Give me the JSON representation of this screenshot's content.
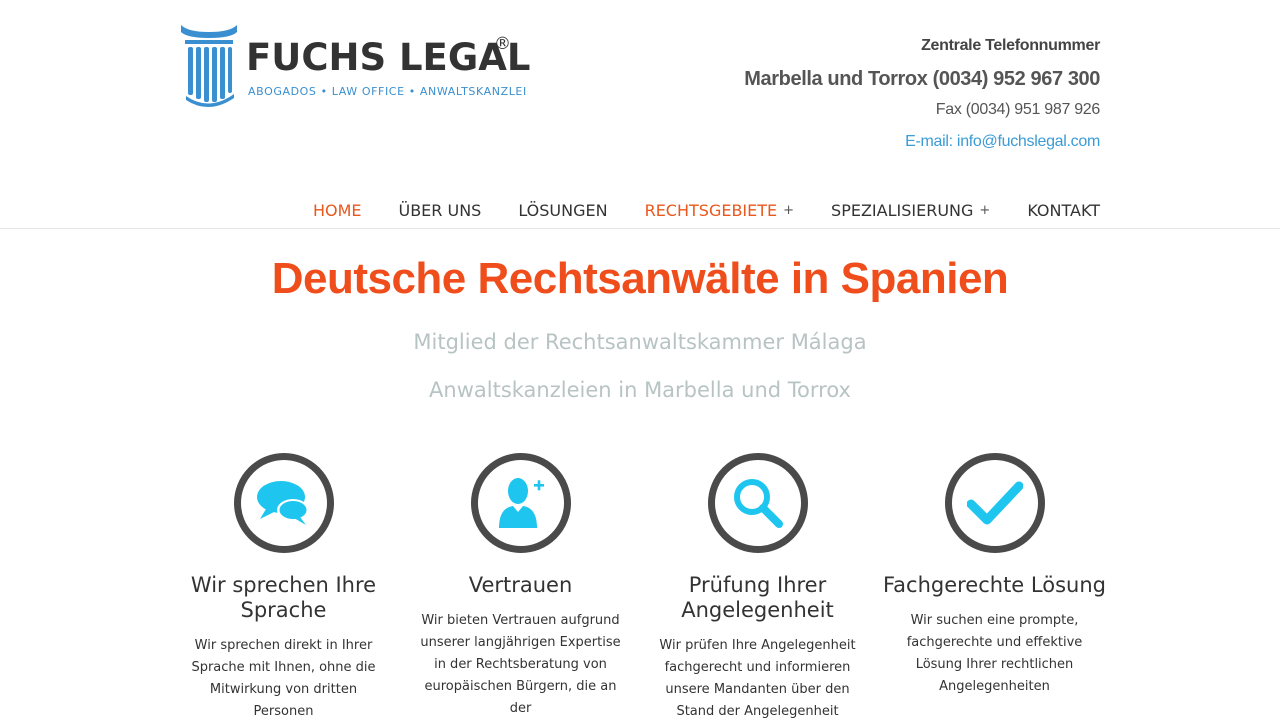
{
  "brand": {
    "name": "FUCHS LEGAL",
    "registered": "®",
    "tagline": "ABOGADOS  •  LAW OFFICE  •  ANWALTSKANZLEI",
    "colors": {
      "primary_blue": "#3a8fd0",
      "accent_orange": "#ef4e1c",
      "icon_cyan": "#1ec6ef"
    }
  },
  "contact": {
    "label": "Zentrale Telefonnummer",
    "phone": "Marbella und Torrox (0034) 952 967 300",
    "fax": "Fax (0034) 951 987 926",
    "email": "E-mail: info@fuchslegal.com"
  },
  "nav": {
    "items": [
      {
        "label": "HOME",
        "active": true
      },
      {
        "label": "ÜBER UNS"
      },
      {
        "label": "LÖSUNGEN"
      },
      {
        "label": "RECHTSGEBIETE",
        "active": true,
        "has_submenu": true
      },
      {
        "label": "SPEZIALISIERUNG",
        "has_submenu": true
      },
      {
        "label": "KONTAKT"
      }
    ],
    "submenu_symbol": "+"
  },
  "hero": {
    "title": "Deutsche Rechtsanwälte in Spanien",
    "subtitle1": "Mitglied der Rechtsanwaltskammer Málaga",
    "subtitle2": "Anwaltskanzleien in Marbella und Torrox"
  },
  "features": [
    {
      "icon": "chat-bubbles-icon",
      "title": "Wir sprechen Ihre Sprache",
      "text": "Wir sprechen direkt in Ihrer Sprache mit Ihnen, ohne die Mitwirkung von dritten Personen"
    },
    {
      "icon": "user-add-icon",
      "title": "Vertrauen",
      "text": "Wir bieten Vertrauen aufgrund unserer langjährigen Expertise in der Rechtsberatung von europäischen Bürgern, die an der"
    },
    {
      "icon": "magnifier-icon",
      "title": "Prüfung Ihrer Angelegenheit",
      "text": "Wir prüfen Ihre Angelegenheit fachgerecht und informieren unsere Mandanten über den Stand der Angelegenheit"
    },
    {
      "icon": "checkmark-icon",
      "title": "Fachgerechte Lösung",
      "text": "Wir suchen eine prompte, fachgerechte und effektive Lösung Ihrer rechtlichen Angelegenheiten"
    }
  ]
}
